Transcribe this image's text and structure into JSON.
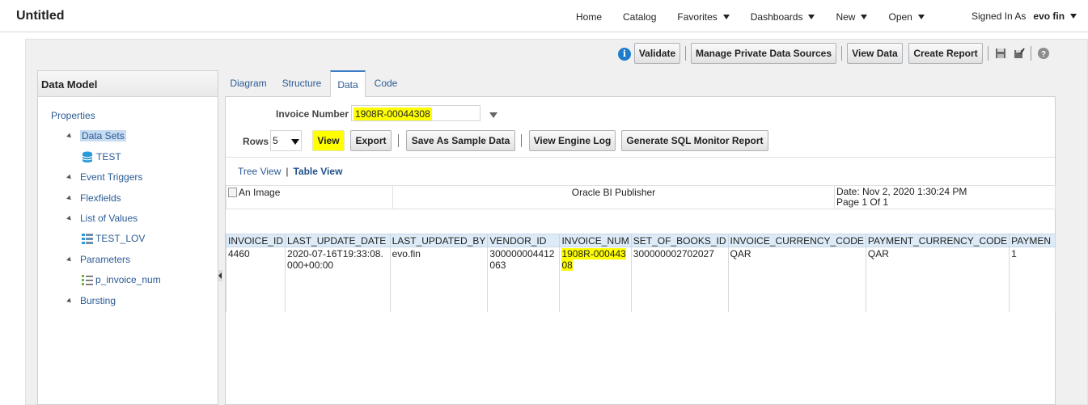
{
  "app": {
    "title": "Untitled"
  },
  "topnav": {
    "items": [
      {
        "label": "Home",
        "dropdown": false
      },
      {
        "label": "Catalog",
        "dropdown": false
      },
      {
        "label": "Favorites",
        "dropdown": true
      },
      {
        "label": "Dashboards",
        "dropdown": true
      },
      {
        "label": "New",
        "dropdown": true
      },
      {
        "label": "Open",
        "dropdown": true
      }
    ],
    "signed_in_label": "Signed In As",
    "user": "evo fin"
  },
  "toolbar": {
    "validate": "Validate",
    "manage_private": "Manage Private Data Sources",
    "view_data": "View Data",
    "create_report": "Create Report",
    "info_glyph": "i"
  },
  "left_panel": {
    "title": "Data Model",
    "tree": [
      {
        "label": "Properties"
      },
      {
        "label": "Data Sets"
      },
      {
        "label": "TEST"
      },
      {
        "label": "Event Triggers"
      },
      {
        "label": "Flexfields"
      },
      {
        "label": "List of Values"
      },
      {
        "label": "TEST_LOV"
      },
      {
        "label": "Parameters"
      },
      {
        "label": "p_invoice_num"
      },
      {
        "label": "Bursting"
      }
    ]
  },
  "tabs": [
    {
      "label": "Diagram"
    },
    {
      "label": "Structure"
    },
    {
      "label": "Data",
      "active": true
    },
    {
      "label": "Code"
    }
  ],
  "params": {
    "invoice_label": "Invoice Number",
    "invoice_value": "1908R-00044308",
    "rows_label": "Rows",
    "rows_value": "5"
  },
  "actions": {
    "view": "View",
    "export": "Export",
    "save_sample": "Save As Sample Data",
    "engine_log": "View Engine Log",
    "sql_monitor": "Generate SQL Monitor Report"
  },
  "view_links": {
    "tree": "Tree View",
    "sep": "|",
    "table": "Table View"
  },
  "report_header": {
    "image_alt": "An Image",
    "publisher": "Oracle BI Publisher",
    "date": "Date: Nov 2, 2020 1:30:24 PM",
    "page": "Page 1 Of 1"
  },
  "grid": {
    "columns": [
      "INVOICE_ID",
      "LAST_UPDATE_DATE",
      "LAST_UPDATED_BY",
      "VENDOR_ID",
      "INVOICE_NUM",
      "SET_OF_BOOKS_ID",
      "INVOICE_CURRENCY_CODE",
      "PAYMENT_CURRENCY_CODE",
      "PAYMEN"
    ],
    "rows": [
      [
        "4460",
        "2020-07-16T19:33:08.000+00:00",
        "evo.fin",
        "300000004412063",
        "1908R-00044308",
        "300000002702027",
        "QAR",
        "QAR",
        "1"
      ]
    ]
  }
}
